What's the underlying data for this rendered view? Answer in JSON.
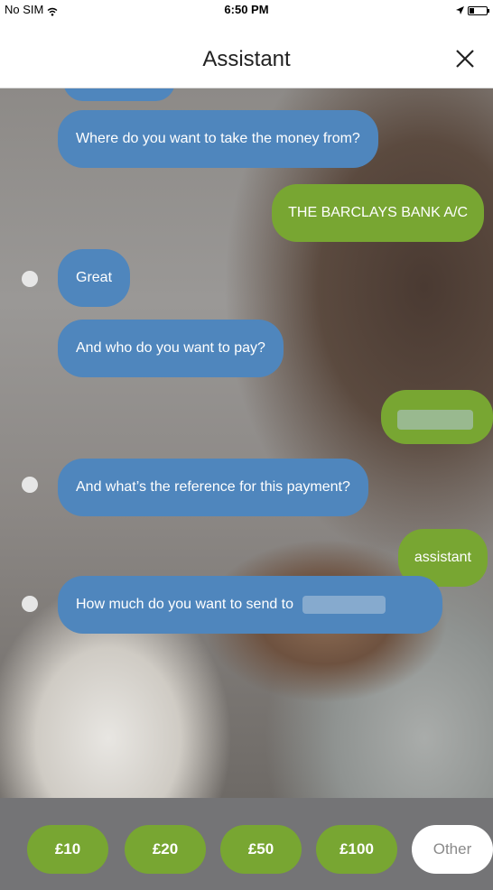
{
  "status_bar": {
    "carrier": "No SIM",
    "time": "6:50 PM"
  },
  "header": {
    "title": "Assistant"
  },
  "messages": [
    {
      "from": "assistant",
      "text": "Where do you want to take the money from?"
    },
    {
      "from": "user",
      "text": "THE BARCLAYS BANK A/C"
    },
    {
      "from": "assistant",
      "text": "Great"
    },
    {
      "from": "assistant",
      "text": "And who do you want to pay?"
    },
    {
      "from": "user",
      "text": ""
    },
    {
      "from": "assistant",
      "text": "And what’s the reference for this payment?"
    },
    {
      "from": "user",
      "text": "assistant"
    },
    {
      "from": "assistant",
      "text": "How much do you want to send to"
    }
  ],
  "quick_replies": [
    "£10",
    "£20",
    "£50",
    "£100",
    "Other"
  ],
  "colors": {
    "assistant_bubble": "#4f86bd",
    "user_bubble": "#78a632",
    "other_button": "#ffffff"
  }
}
